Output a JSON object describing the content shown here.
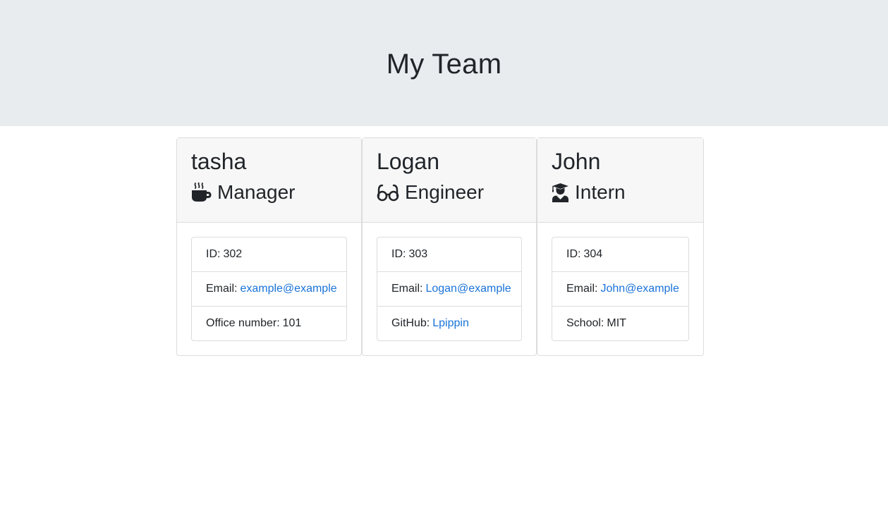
{
  "header": {
    "title": "My Team"
  },
  "team": [
    {
      "name": "tasha",
      "role": "Manager",
      "icon": "mug-icon",
      "id_label": "ID:",
      "id": "302",
      "email_label": "Email:",
      "email": "example@example",
      "extra_label": "Office number:",
      "extra": "101",
      "extra_is_link": false
    },
    {
      "name": "Logan",
      "role": "Engineer",
      "icon": "glasses-icon",
      "id_label": "ID:",
      "id": "303",
      "email_label": "Email:",
      "email": "Logan@example",
      "extra_label": "GitHub:",
      "extra": "Lpippin",
      "extra_is_link": true
    },
    {
      "name": "John",
      "role": "Intern",
      "icon": "graduate-icon",
      "id_label": "ID:",
      "id": "304",
      "email_label": "Email:",
      "email": "John@example",
      "extra_label": "School:",
      "extra": "MIT",
      "extra_is_link": false
    }
  ],
  "colors": {
    "link": "#1a73d9",
    "jumbotron_bg": "#e9ecef",
    "header_bg": "#f7f7f7"
  }
}
